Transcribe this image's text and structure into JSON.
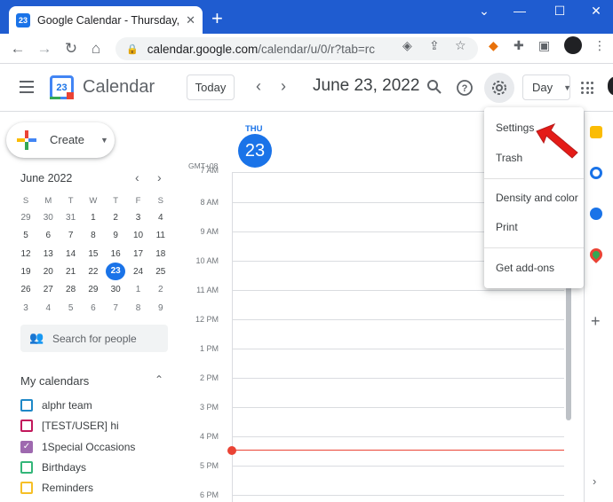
{
  "browser": {
    "tab_title": "Google Calendar - Thursday, June",
    "tab_favicon": "23",
    "url_host": "calendar.google.com",
    "url_path": "/calendar/u/0/r?tab=rc",
    "new_tab_label": "+",
    "window_buttons": [
      "⌄",
      "—",
      "☐",
      "✕"
    ]
  },
  "header": {
    "app_name": "Calendar",
    "logo_day": "23",
    "today_label": "Today",
    "date_title": "June 23, 2022",
    "view_label": "Day"
  },
  "sidebar": {
    "create_label": "Create",
    "mini_calendar": {
      "title": "June 2022",
      "weekdays": [
        "S",
        "M",
        "T",
        "W",
        "T",
        "F",
        "S"
      ],
      "weeks": [
        [
          "29",
          "30",
          "31",
          "1",
          "2",
          "3",
          "4"
        ],
        [
          "5",
          "6",
          "7",
          "8",
          "9",
          "10",
          "11"
        ],
        [
          "12",
          "13",
          "14",
          "15",
          "16",
          "17",
          "18"
        ],
        [
          "19",
          "20",
          "21",
          "22",
          "23",
          "24",
          "25"
        ],
        [
          "26",
          "27",
          "28",
          "29",
          "30",
          "1",
          "2"
        ],
        [
          "3",
          "4",
          "5",
          "6",
          "7",
          "8",
          "9"
        ]
      ],
      "today": "23"
    },
    "people_search_placeholder": "Search for people",
    "my_calendars_title": "My calendars",
    "calendars": [
      {
        "label": "alphr team",
        "color": "#1e88c7",
        "checked": false
      },
      {
        "label": "[TEST/USER] hi",
        "color": "#c2185b",
        "checked": false
      },
      {
        "label": "1Special Occasions",
        "color": "#9e69af",
        "checked": true
      },
      {
        "label": "Birthdays",
        "color": "#33b679",
        "checked": false
      },
      {
        "label": "Reminders",
        "color": "#f6bf26",
        "checked": false
      }
    ]
  },
  "day_view": {
    "day_name": "THU",
    "day_number": "23",
    "timezone": "GMT+08",
    "hours": [
      "7 AM",
      "8 AM",
      "9 AM",
      "10 AM",
      "11 AM",
      "12 PM",
      "1 PM",
      "2 PM",
      "3 PM",
      "4 PM",
      "5 PM",
      "6 PM"
    ]
  },
  "settings_menu": {
    "items": [
      "Settings",
      "Trash",
      "Density and color",
      "Print",
      "Get add-ons"
    ]
  },
  "colors": {
    "accent": "#1a73e8",
    "now_line": "#ea4335",
    "annotation_arrow": "#e41b17"
  }
}
